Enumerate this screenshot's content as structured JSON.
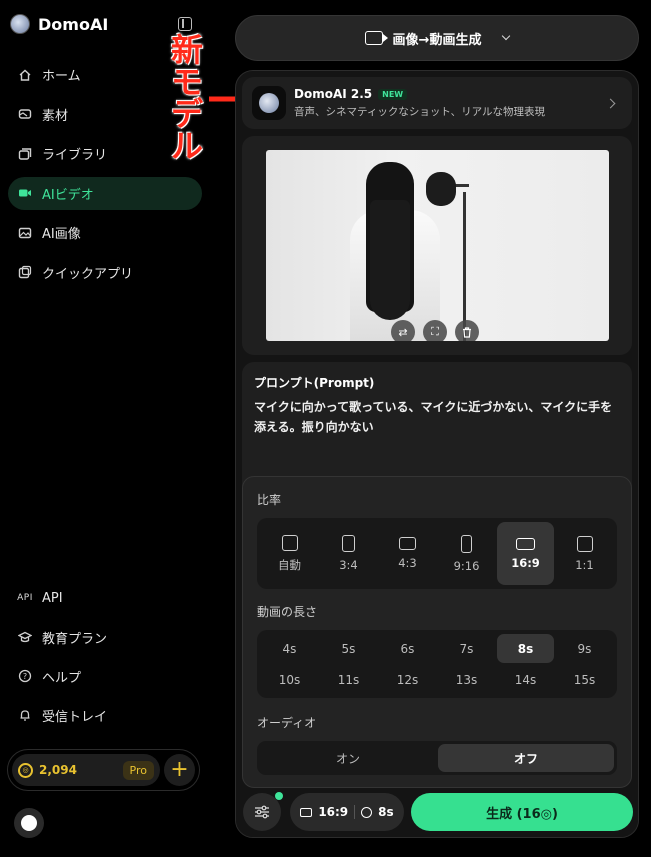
{
  "app": {
    "name": "DomoAI"
  },
  "sidebar": {
    "items": [
      {
        "label": "ホーム",
        "icon": "home-icon"
      },
      {
        "label": "素材",
        "icon": "assets-icon"
      },
      {
        "label": "ライブラリ",
        "icon": "library-icon"
      },
      {
        "label": "AIビデオ",
        "icon": "video-icon",
        "active": true
      },
      {
        "label": "AI画像",
        "icon": "image-icon"
      },
      {
        "label": "クイックアプリ",
        "icon": "quick-apps-icon"
      }
    ],
    "bottom_items": [
      {
        "label": "API",
        "icon": "api-icon",
        "icon_text": "API"
      },
      {
        "label": "教育プラン",
        "icon": "education-icon"
      },
      {
        "label": "ヘルプ",
        "icon": "help-icon"
      },
      {
        "label": "受信トレイ",
        "icon": "bell-icon"
      }
    ],
    "credits": {
      "value": "2,094",
      "plan": "Pro",
      "plus": "+"
    }
  },
  "annotation": {
    "text": "新モデル"
  },
  "header": {
    "mode_label": "画像→動画生成"
  },
  "model": {
    "name": "DomoAI 2.5",
    "badge": "NEW",
    "description": "音声、シネマティックなショット、リアルな物理表現"
  },
  "prompt": {
    "title": "プロンプト(Prompt)",
    "text": "マイクに向かって歌っている、マイクに近づかない、マイクに手を添える。振り向かない"
  },
  "settings": {
    "ratio_title": "比率",
    "ratios": [
      "自動",
      "3:4",
      "4:3",
      "9:16",
      "16:9",
      "1:1"
    ],
    "ratio_selected": "16:9",
    "duration_title": "動画の長さ",
    "durations": [
      "4s",
      "5s",
      "6s",
      "7s",
      "8s",
      "9s",
      "10s",
      "11s",
      "12s",
      "13s",
      "14s",
      "15s"
    ],
    "duration_selected": "8s",
    "audio_title": "オーディオ",
    "audio_options": [
      "オン",
      "オフ"
    ],
    "audio_selected": "オフ"
  },
  "bottom": {
    "ratio": "16:9",
    "duration": "8s",
    "generate_label": "生成 (16◎)"
  },
  "colors": {
    "accent": "#36e090",
    "credits": "#e8c230",
    "annotation": "#ff2a1a"
  }
}
